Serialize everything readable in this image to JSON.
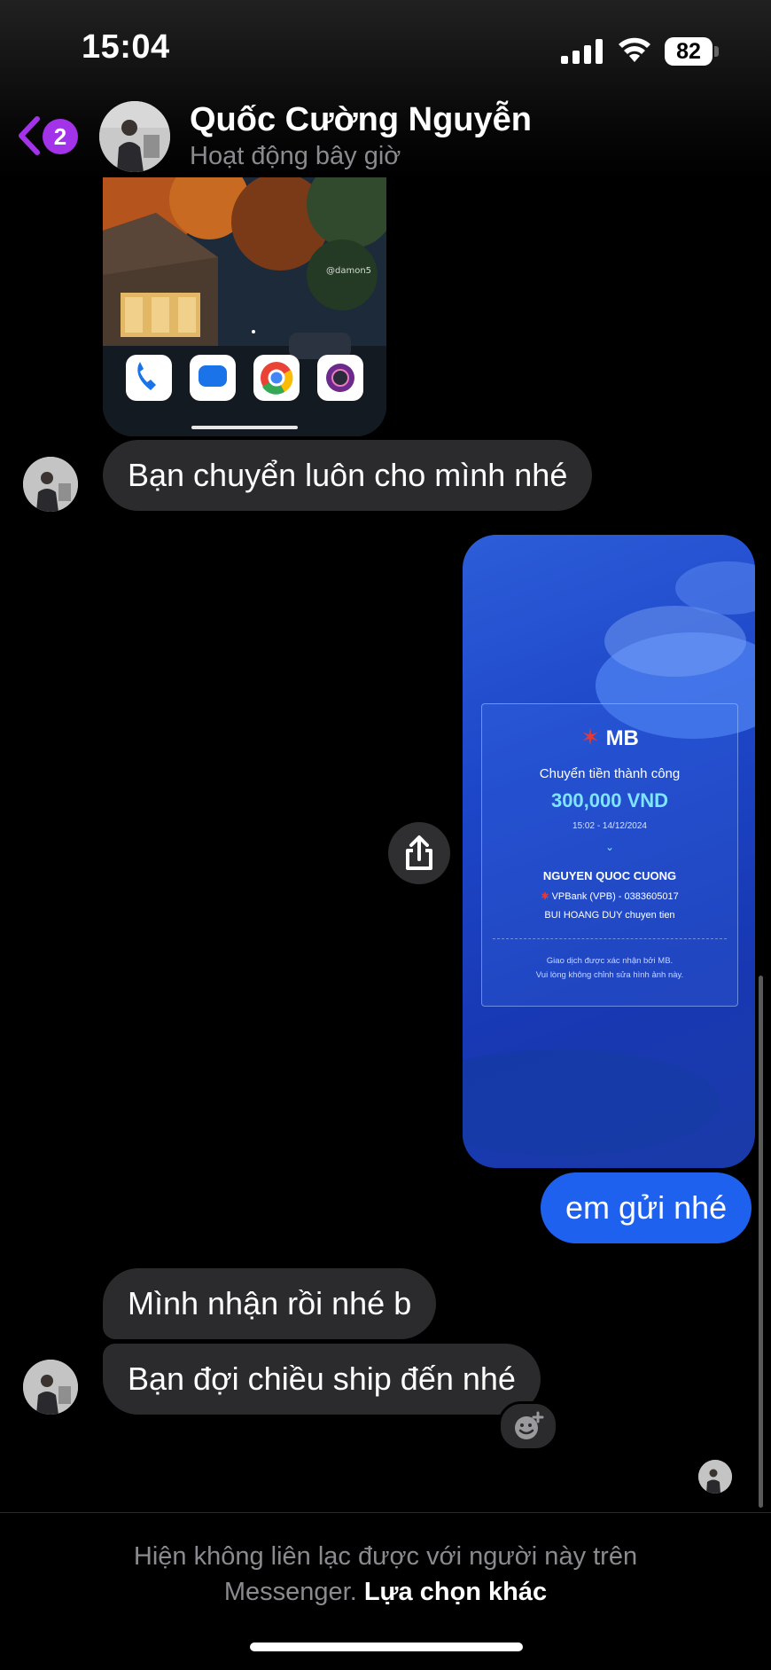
{
  "status_bar": {
    "time": "15:04",
    "battery": "82"
  },
  "header": {
    "back_badge": "2",
    "contact_name": "Quốc Cường Nguyễn",
    "contact_status": "Hoạt động bây giờ"
  },
  "top_image": {
    "watermark": "@damon5"
  },
  "messages": [
    {
      "side": "incoming",
      "text": "Bạn chuyển luôn cho mình nhé"
    },
    {
      "side": "outgoing",
      "text": "em gửi nhé"
    },
    {
      "side": "incoming",
      "text": "Mình nhận rồi nhé b"
    },
    {
      "side": "incoming",
      "text": "Bạn đợi chiều ship đến nhé"
    }
  ],
  "receipt": {
    "bank_logo": "MB",
    "title": "Chuyển tiền thành công",
    "amount": "300,000 VND",
    "datetime": "15:02 - 14/12/2024",
    "recipient": "NGUYEN QUOC CUONG",
    "recipient_bank": "VPBank (VPB) - 0383605017",
    "note": "BUI HOANG DUY chuyen tien",
    "footer_line1": "Giao dịch được xác nhận bởi MB.",
    "footer_line2": "Vui lòng không chỉnh sửa hình ảnh này."
  },
  "footer": {
    "line1": "Hiện không liên lạc được với người này trên",
    "line2": "Messenger.",
    "link": "Lựa chọn khác"
  },
  "colors": {
    "outgoing_bubble": "#1f61ef",
    "incoming_bubble": "#2b2b2d",
    "accent": "#a233e8"
  }
}
